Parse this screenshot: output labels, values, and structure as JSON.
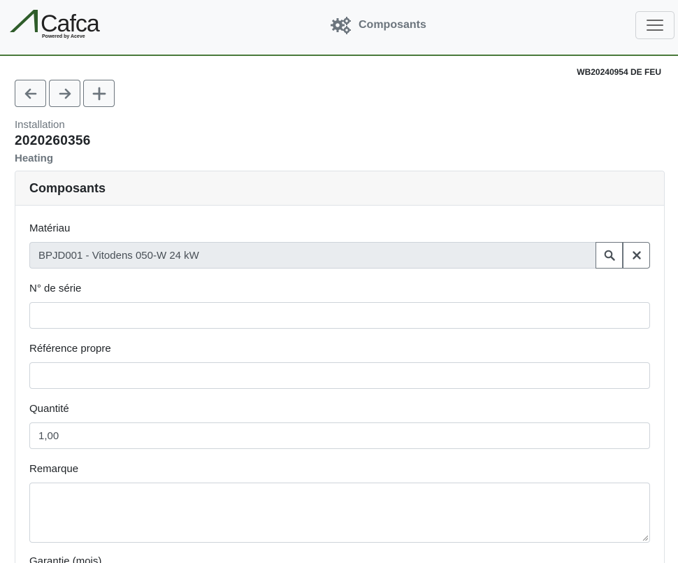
{
  "header": {
    "logo_text": "Cafca",
    "logo_subtext": "Powered by Aceve",
    "page_title": "Composants",
    "page_icon": "gears-icon",
    "menu_icon": "hamburger-menu-icon"
  },
  "order_ref": "WB20240954 DE FEU",
  "nav": {
    "buttons": [
      {
        "icon": "arrow-left-icon"
      },
      {
        "icon": "arrow-right-icon"
      },
      {
        "icon": "plus-icon"
      }
    ]
  },
  "installation": {
    "label": "Installation",
    "number": "2020260356",
    "type": "Heating"
  },
  "card": {
    "title": "Composants",
    "fields": {
      "material": {
        "label": "Matériau",
        "value": "BPJD001 - Vitodens 050-W 24 kW"
      },
      "serial": {
        "label": "N° de série",
        "value": ""
      },
      "own_ref": {
        "label": "Référence propre",
        "value": ""
      },
      "quantity": {
        "label": "Quantité",
        "value": "1,00"
      },
      "remark": {
        "label": "Remarque",
        "value": ""
      },
      "warranty": {
        "label": "Garantie (mois)"
      }
    }
  },
  "colors": {
    "accent_green": "#4a7a3a",
    "muted_text": "#6c757d",
    "readonly_bg": "#e9ecef"
  }
}
